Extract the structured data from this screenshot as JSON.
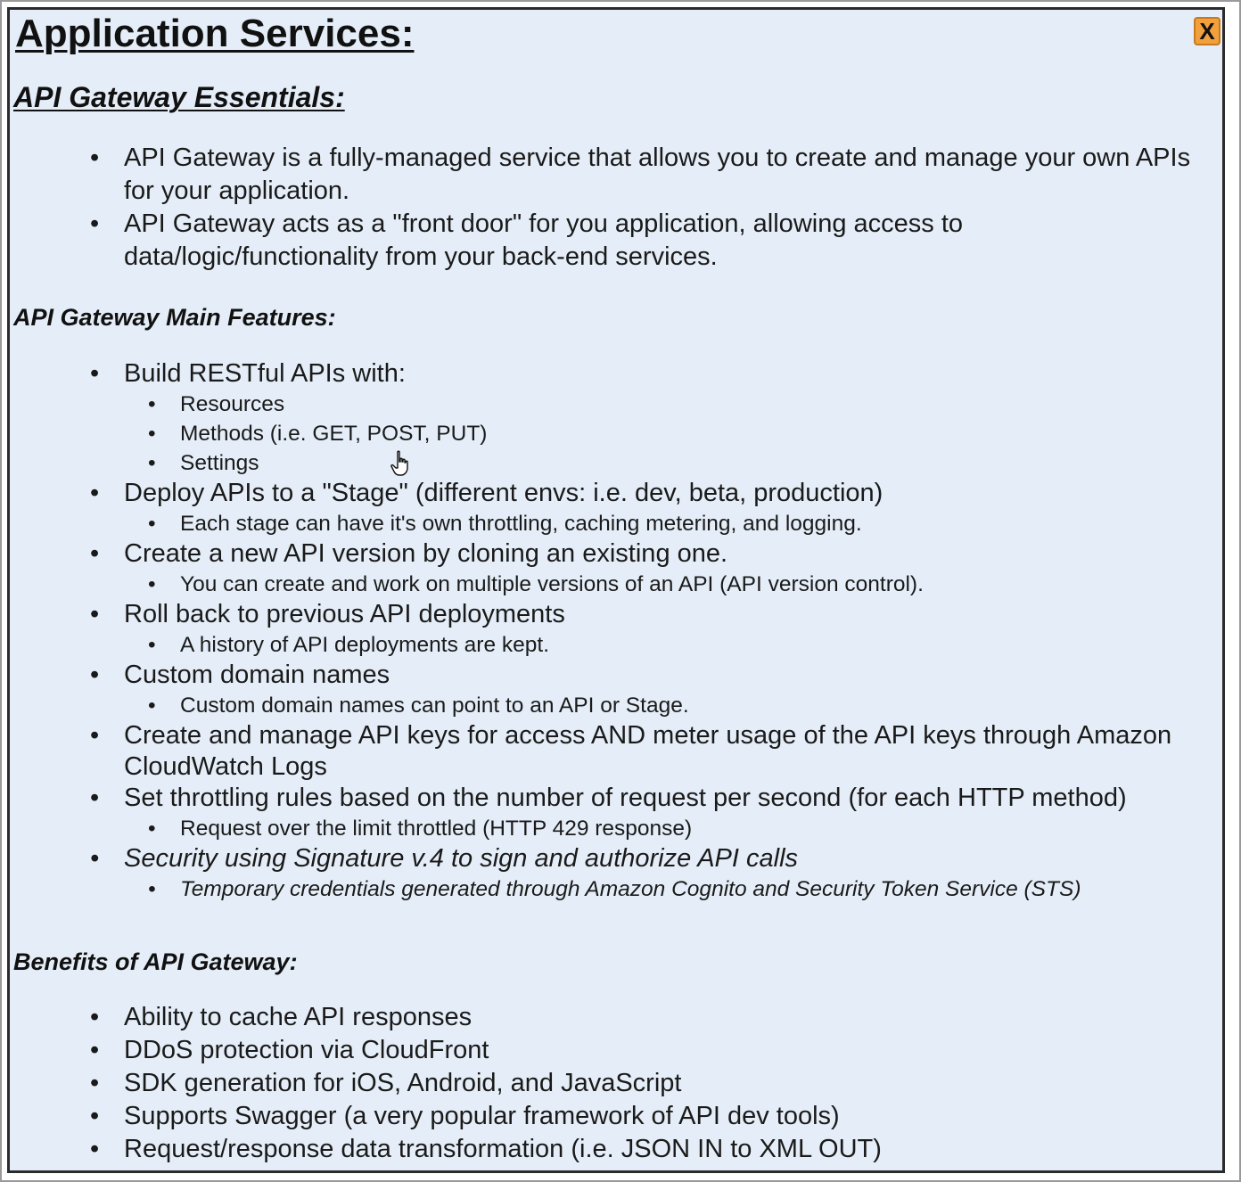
{
  "window": {
    "title": "Application Services:",
    "close_label": "X"
  },
  "essentials": {
    "heading": "API Gateway Essentials:",
    "items": [
      "API Gateway is a fully-managed service that allows you to create and manage your own APIs for your application.",
      "API Gateway acts as a \"front door\" for you application, allowing access to data/logic/functionality from your back-end services."
    ]
  },
  "features": {
    "heading": "API Gateway Main Features:",
    "items": [
      {
        "text": "Build RESTful APIs with:",
        "subs": [
          "Resources",
          "Methods (i.e. GET, POST, PUT)",
          "Settings"
        ]
      },
      {
        "text": "Deploy APIs to a \"Stage\" (different envs: i.e. dev, beta, production)",
        "subs": [
          "Each stage can have it's own throttling, caching metering, and logging."
        ]
      },
      {
        "text": "Create a new API version by cloning an existing one.",
        "subs": [
          "You can create and work on multiple versions of an API (API version control)."
        ]
      },
      {
        "text": "Roll back to previous API deployments",
        "subs": [
          "A history of API deployments are kept."
        ]
      },
      {
        "text": "Custom domain names",
        "subs": [
          "Custom domain names can point to an API or Stage."
        ]
      },
      {
        "text": "Create and manage API keys for access AND meter usage of the API keys through Amazon CloudWatch Logs",
        "subs": []
      },
      {
        "text": "Set throttling rules based on the number of request per second (for each HTTP method)",
        "subs": [
          "Request over the limit throttled (HTTP 429 response)"
        ]
      },
      {
        "text": "Security using Signature v.4 to sign and authorize API calls",
        "subs": [
          "Temporary credentials generated through Amazon Cognito and Security Token Service (STS)"
        ]
      }
    ]
  },
  "benefits": {
    "heading": "Benefits of API Gateway:",
    "items": [
      "Ability to cache API responses",
      "DDoS protection via CloudFront",
      "SDK generation for iOS, Android, and JavaScript",
      "Supports Swagger (a very popular framework of API dev tools)",
      "Request/response data transformation (i.e. JSON IN to XML OUT)"
    ]
  },
  "colors": {
    "panel_background": "#e5eef8",
    "close_button": "#f2a03c",
    "text": "#1a1a1a"
  },
  "icons": {
    "cursor": "hand-pointer-icon"
  }
}
